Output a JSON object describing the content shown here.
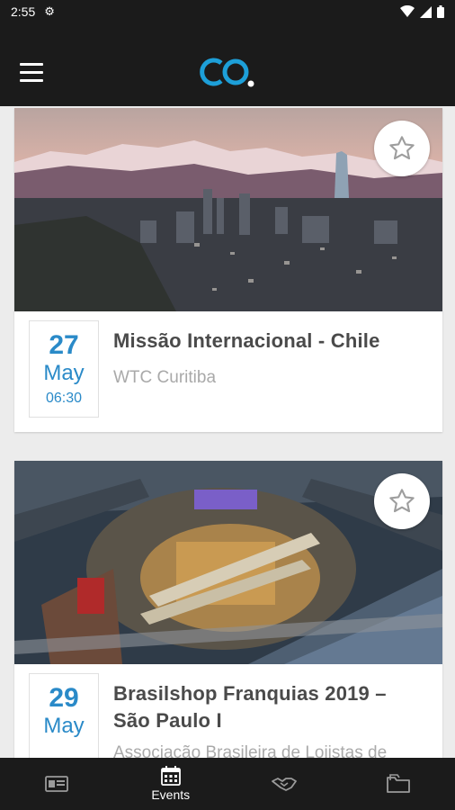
{
  "status_bar": {
    "time": "2:55"
  },
  "colors": {
    "accent": "#2a8ac8",
    "bar_bg": "#1b1b1b",
    "logo": "#1d9fd8"
  },
  "events": [
    {
      "day": "27",
      "month": "May",
      "time": "06:30",
      "title": "Missão Internacional - Chile",
      "venue": "WTC Curitiba"
    },
    {
      "day": "29",
      "month": "May",
      "title": "Brasilshop Franquias 2019 – São Paulo I",
      "venue": "Associação Brasileira de Lojistas de"
    }
  ],
  "bottom_nav": [
    {
      "icon": "id-card-icon",
      "label": ""
    },
    {
      "icon": "calendar-icon",
      "label": "Events",
      "active": true
    },
    {
      "icon": "handshake-icon",
      "label": ""
    },
    {
      "icon": "folder-icon",
      "label": ""
    }
  ]
}
